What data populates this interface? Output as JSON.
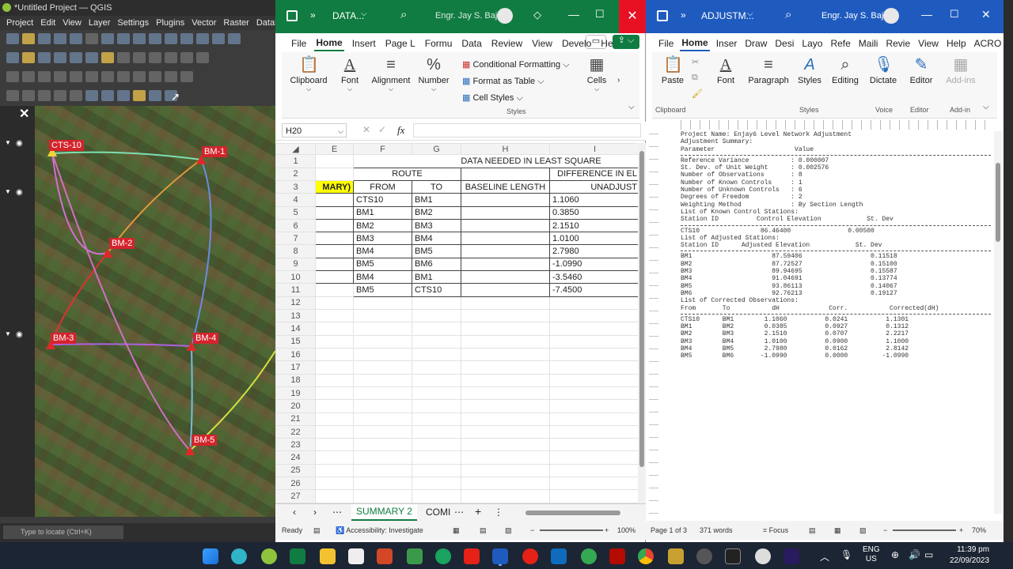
{
  "qgis": {
    "title": "*Untitled Project — QGIS",
    "menu": [
      "Project",
      "Edit",
      "View",
      "Layer",
      "Settings",
      "Plugins",
      "Vector",
      "Raster",
      "Database"
    ],
    "locate_placeholder": "Type to locate (Ctrl+K)",
    "stations": [
      {
        "name": "CTS-10"
      },
      {
        "name": "BM-1"
      },
      {
        "name": "BM-2"
      },
      {
        "name": "BM-3"
      },
      {
        "name": "BM-4"
      },
      {
        "name": "BM-5"
      }
    ]
  },
  "excel": {
    "title": "DATA...",
    "user": "Engr. Jay S. Bajo",
    "tabs": [
      "File",
      "Home",
      "Insert",
      "Page L",
      "Formu",
      "Data",
      "Review",
      "View",
      "Develo",
      "Help"
    ],
    "groups": {
      "clipboard": "Clipboard",
      "font": "Font",
      "alignment": "Alignment",
      "number": "Number",
      "cells": "Cells",
      "styles": "Styles"
    },
    "styles_items": [
      "Conditional Formatting",
      "Format as Table",
      "Cell Styles"
    ],
    "name_box": "H20",
    "fx": "fx",
    "col_headers": [
      "E",
      "F",
      "G",
      "H",
      "I"
    ],
    "title_row": "DATA NEEDED IN LEAST SQUARE",
    "route_label": "ROUTE",
    "diff_label": "DIFFERENCE IN EL",
    "e3": "MARY)",
    "from_label": "FROM",
    "to_label": "TO",
    "baseline_label": "BASELINE LENGTH",
    "unadj_label": "UNADJUST",
    "rows": [
      {
        "from": "CTS10",
        "to": "BM1",
        "value": "1.1060"
      },
      {
        "from": "BM1",
        "to": "BM2",
        "value": "0.3850"
      },
      {
        "from": "BM2",
        "to": "BM3",
        "value": "2.1510"
      },
      {
        "from": "BM3",
        "to": "BM4",
        "value": "1.0100"
      },
      {
        "from": "BM4",
        "to": "BM5",
        "value": "2.7980"
      },
      {
        "from": "BM5",
        "to": "BM6",
        "value": "-1.0990"
      },
      {
        "from": "BM4",
        "to": "BM1",
        "value": "-3.5460"
      },
      {
        "from": "BM5",
        "to": "CTS10",
        "value": "-7.4500"
      }
    ],
    "sheet_active": "SUMMARY 2",
    "sheet_other": "COMI",
    "status_ready": "Ready",
    "status_access": "Accessibility: Investigate",
    "zoom": "100%"
  },
  "word": {
    "title": "ADJUSTM...",
    "user": "Engr. Jay S. Bajo",
    "tabs": [
      "File",
      "Home",
      "Inser",
      "Draw",
      "Desi",
      "Layo",
      "Refe",
      "Maili",
      "Revie",
      "View",
      "Help",
      "ACRO"
    ],
    "groups": [
      "Paste",
      "Font",
      "Paragraph",
      "Styles",
      "Editing",
      "Dictate",
      "Editor",
      "Add-ins"
    ],
    "group_labels": [
      "Clipboard",
      "Styles",
      "Voice",
      "Editor",
      "Add-in"
    ],
    "doc_lines": [
      "Project Name: Enjay6 Level Network Adjustment",
      "",
      "",
      "Adjustment Summary:",
      "",
      "Parameter                     Value",
      "HR",
      "Reference Variance           : 0.000007",
      "St. Dev. of Unit Weight      : 0.002576",
      "Number of Observations       : 8",
      "Number of Known Controls     : 1",
      "Number of Unknown Controls   : 6",
      "Degrees of Freedom           : 2",
      "Weighting Method             : By Section Length",
      "",
      "",
      "List of Known Control Stations:",
      "",
      "Station ID          Control Elevation            St. Dev",
      "HR",
      "CTS10                86.46400               0.00500",
      "",
      "",
      "List of Adjusted Stations:",
      "",
      "Station ID      Adjusted Elevation            St. Dev",
      "HR",
      "BM1                     87.59406                  0.11518",
      "BM2                     87.72527                  0.15100",
      "BM3                     89.94695                  0.15587",
      "BM4                     91.04691                  0.13774",
      "BM5                     93.86113                  0.14067",
      "BM6                     92.76213                  0.19127",
      "",
      "",
      "List of Corrected Observations:",
      "",
      "From       To           dH             Corr.           Corrected(dH)",
      "HR",
      "CTS10      BM1        1.1060          0.0241          1.1301",
      "",
      "BM1        BM2        0.0385          0.0927          0.1312",
      "",
      "BM2        BM3        2.1510          0.0707          2.2217",
      "",
      "BM3        BM4        1.0100          0.0900          1.1000",
      "",
      "BM4        BM5        2.7980          0.0162          2.8142",
      "",
      "BM5        BM6       -1.0990          0.0000         -1.0990"
    ],
    "status_page": "Page 1 of 3",
    "status_words": "371 words",
    "status_focus": "Focus",
    "zoom": "70%"
  },
  "taskbar": {
    "lang1": "ENG",
    "lang2": "US",
    "time": "11:39 pm",
    "date": "22/09/2023"
  }
}
